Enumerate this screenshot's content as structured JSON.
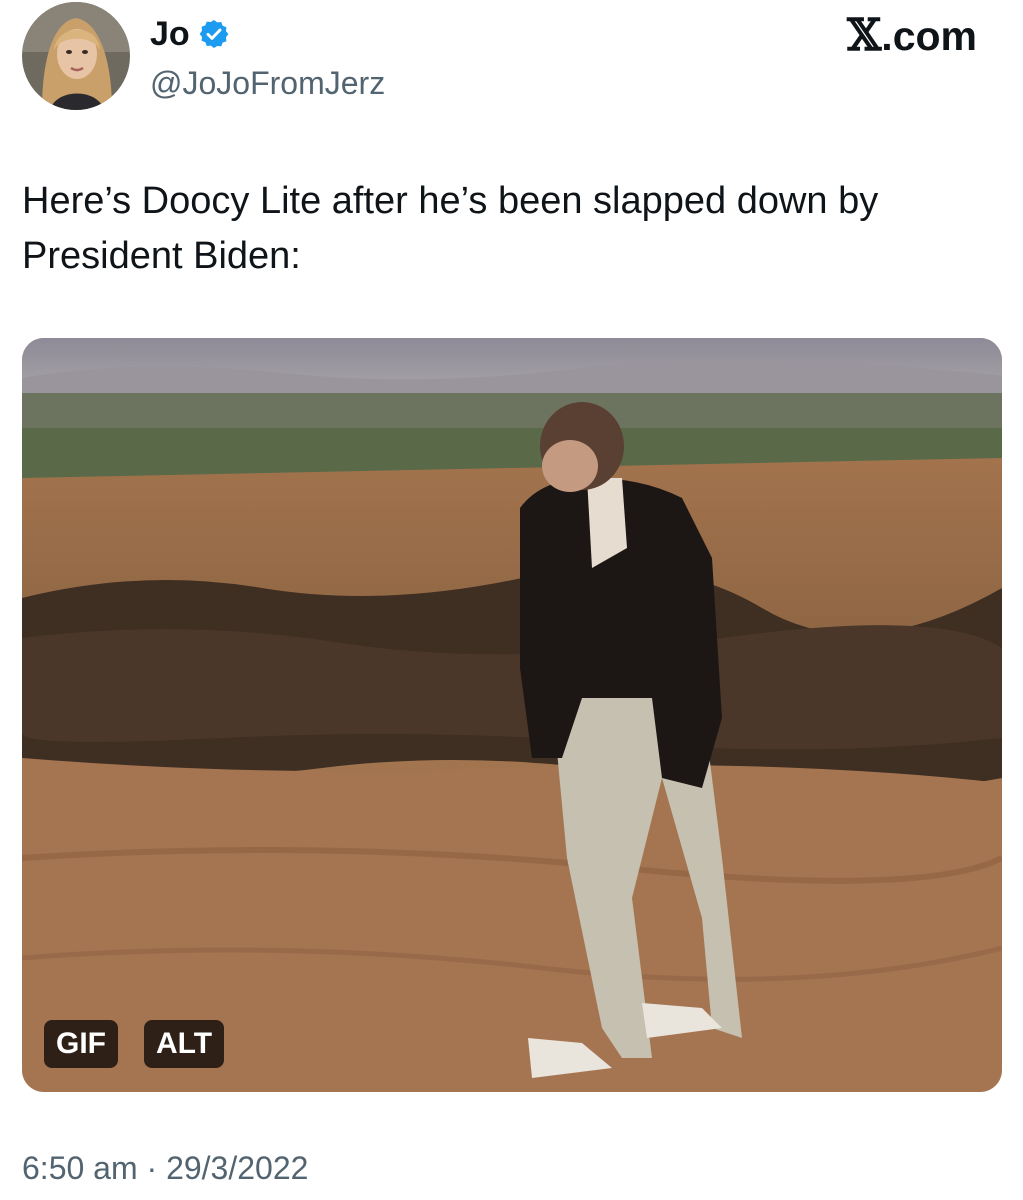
{
  "author": {
    "display_name": "Jo",
    "handle": "@JoJoFromJerz",
    "avatar_icon": "profile-photo",
    "verified_icon": "verified-badge-icon",
    "verified_color": "#1d9bf0"
  },
  "brand": {
    "x_glyph": "𝕏",
    "label": ".com"
  },
  "tweet": {
    "text": "Here’s Doocy Lite after he’s been slapped down by President Biden:",
    "timestamp": "6:50 am · 29/3/2022"
  },
  "media": {
    "type": "gif",
    "badges": {
      "gif": "GIF",
      "alt": "ALT"
    }
  },
  "colors": {
    "text_primary": "#0f1419",
    "text_secondary": "#536471"
  }
}
